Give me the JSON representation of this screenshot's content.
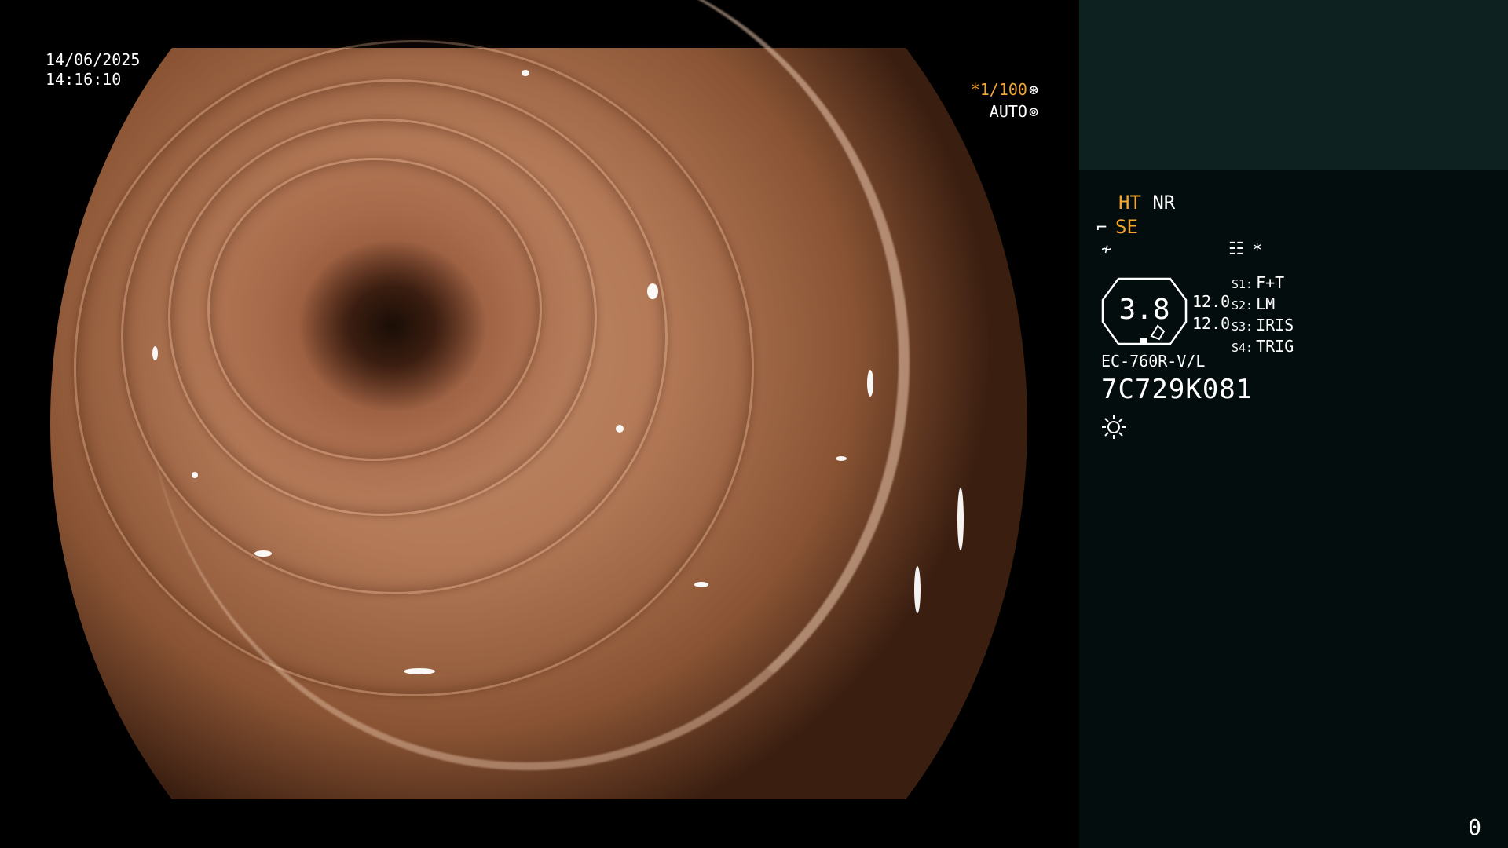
{
  "overlay": {
    "date": "14/06/2025",
    "time": "14:16:10",
    "shutter_speed": "*1/100",
    "shutter_mode": "AUTO"
  },
  "side_panel": {
    "modes": {
      "ht": "HT",
      "nr": "NR",
      "se": "SE"
    },
    "zoom_value": "3.8",
    "gain_values": [
      "12.0",
      "12.0"
    ],
    "switches": [
      {
        "key": "S1:",
        "value": "F+T"
      },
      {
        "key": "S2:",
        "value": "LM"
      },
      {
        "key": "S3:",
        "value": "IRIS"
      },
      {
        "key": "S4:",
        "value": "TRIG"
      }
    ],
    "scope_model": "EC-760R-V/L",
    "scope_serial": "7C729K081",
    "asterisk": "*",
    "page_counter": "0"
  },
  "icons": {
    "shutter_icon": "aperture-icon",
    "auto_icon": "iris-icon",
    "se_icon": "structure-enhance-icon",
    "color_icon": "color-mode-icon",
    "menu_icon": "settings-list-icon",
    "light_icon": "sun-icon"
  },
  "colors": {
    "accent": "#f2a531",
    "panel": "#040d0d",
    "patient_box": "#0d2121"
  }
}
